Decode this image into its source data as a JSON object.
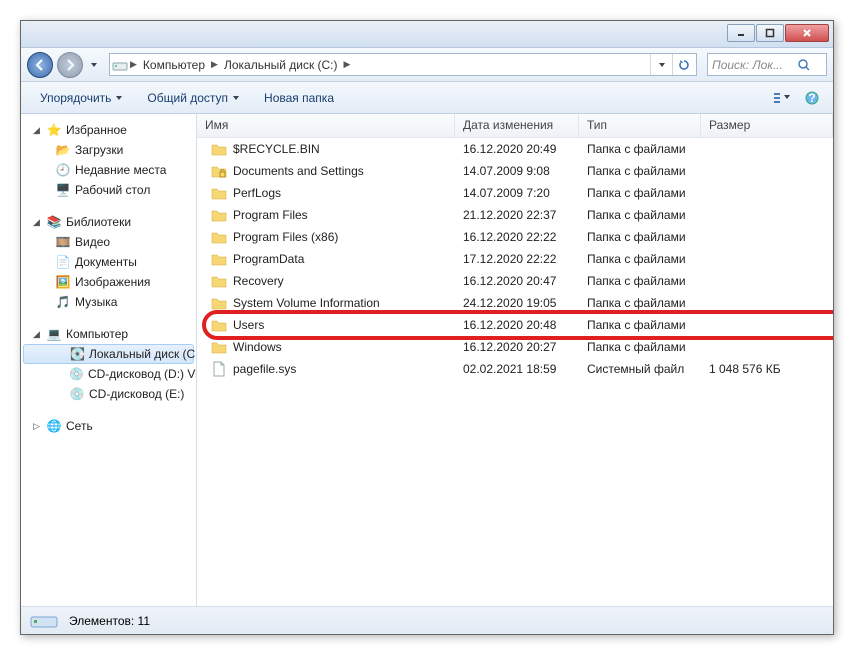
{
  "titlebar": {},
  "nav": {
    "breadcrumbs": [
      {
        "label": "Компьютер"
      },
      {
        "label": "Локальный диск (C:)"
      }
    ],
    "search_placeholder": "Поиск: Лок..."
  },
  "toolbar": {
    "organize": "Упорядочить",
    "share": "Общий доступ",
    "newfolder": "Новая папка"
  },
  "tree": {
    "favorites": {
      "label": "Избранное",
      "items": [
        "Загрузки",
        "Недавние места",
        "Рабочий стол"
      ]
    },
    "libraries": {
      "label": "Библиотеки",
      "items": [
        "Видео",
        "Документы",
        "Изображения",
        "Музыка"
      ]
    },
    "computer": {
      "label": "Компьютер",
      "items": [
        "Локальный диск (C:)",
        "CD-дисковод (D:) Vi",
        "CD-дисковод (E:)"
      ]
    },
    "network": {
      "label": "Сеть"
    }
  },
  "columns": {
    "name": "Имя",
    "date": "Дата изменения",
    "type": "Тип",
    "size": "Размер"
  },
  "rows": [
    {
      "name": "$RECYCLE.BIN",
      "date": "16.12.2020 20:49",
      "type": "Папка с файлами",
      "size": "",
      "icon": "folder"
    },
    {
      "name": "Documents and Settings",
      "date": "14.07.2009 9:08",
      "type": "Папка с файлами",
      "size": "",
      "icon": "folder-lock"
    },
    {
      "name": "PerfLogs",
      "date": "14.07.2009 7:20",
      "type": "Папка с файлами",
      "size": "",
      "icon": "folder"
    },
    {
      "name": "Program Files",
      "date": "21.12.2020 22:37",
      "type": "Папка с файлами",
      "size": "",
      "icon": "folder"
    },
    {
      "name": "Program Files (x86)",
      "date": "16.12.2020 22:22",
      "type": "Папка с файлами",
      "size": "",
      "icon": "folder"
    },
    {
      "name": "ProgramData",
      "date": "17.12.2020 22:22",
      "type": "Папка с файлами",
      "size": "",
      "icon": "folder"
    },
    {
      "name": "Recovery",
      "date": "16.12.2020 20:47",
      "type": "Папка с файлами",
      "size": "",
      "icon": "folder"
    },
    {
      "name": "System Volume Information",
      "date": "24.12.2020 19:05",
      "type": "Папка с файлами",
      "size": "",
      "icon": "folder"
    },
    {
      "name": "Users",
      "date": "16.12.2020 20:48",
      "type": "Папка с файлами",
      "size": "",
      "icon": "folder",
      "highlight": true
    },
    {
      "name": "Windows",
      "date": "16.12.2020 20:27",
      "type": "Папка с файлами",
      "size": "",
      "icon": "folder"
    },
    {
      "name": "pagefile.sys",
      "date": "02.02.2021 18:59",
      "type": "Системный файл",
      "size": "1 048 576 КБ",
      "icon": "file"
    }
  ],
  "status": {
    "count": "Элементов: 11"
  }
}
